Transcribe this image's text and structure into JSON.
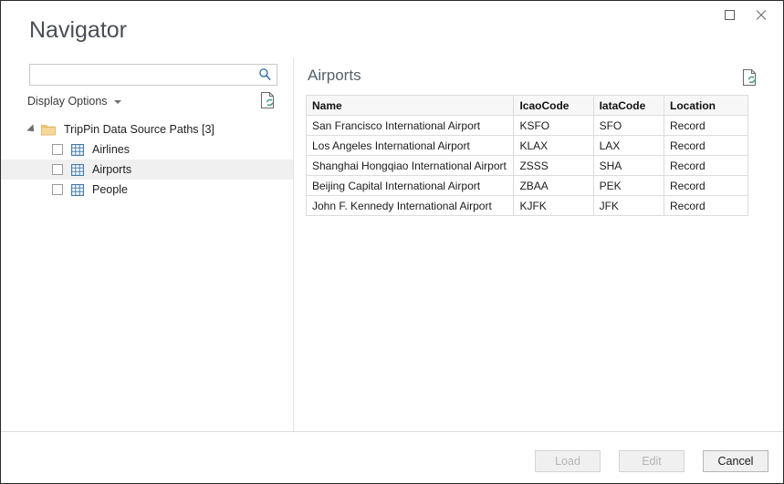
{
  "window": {
    "title": "Navigator",
    "controls": [
      {
        "name": "maximize-button",
        "icon": "maximize-icon",
        "label": "Maximize"
      },
      {
        "name": "close-button",
        "icon": "close-icon",
        "label": "Close"
      }
    ]
  },
  "search": {
    "value": "",
    "placeholder": "",
    "icon": "search-icon"
  },
  "display_options": {
    "label": "Display Options",
    "caret_icon": "chevron-down-icon"
  },
  "left_refresh": {
    "icon": "refresh-document-icon"
  },
  "right_refresh": {
    "icon": "refresh-document-icon"
  },
  "tree": {
    "root": {
      "label": "TripPin Data Source Paths [3]",
      "expander_icon": "expander-expanded-icon",
      "folder_icon": "folder-icon",
      "expanded": true
    },
    "items": [
      {
        "label": "Airlines",
        "checked": false,
        "selected": false,
        "icon": "table-grid-icon"
      },
      {
        "label": "Airports",
        "checked": false,
        "selected": true,
        "icon": "table-grid-icon"
      },
      {
        "label": "People",
        "checked": false,
        "selected": false,
        "icon": "table-grid-icon"
      }
    ]
  },
  "preview": {
    "title": "Airports",
    "columns": [
      "Name",
      "IcaoCode",
      "IataCode",
      "Location"
    ],
    "column_widths": [
      "47%",
      "18%",
      "16%",
      "19%"
    ],
    "rows": [
      [
        "San Francisco International Airport",
        "KSFO",
        "SFO",
        "Record"
      ],
      [
        "Los Angeles International Airport",
        "KLAX",
        "LAX",
        "Record"
      ],
      [
        "Shanghai Hongqiao International Airport",
        "ZSSS",
        "SHA",
        "Record"
      ],
      [
        "Beijing Capital International Airport",
        "ZBAA",
        "PEK",
        "Record"
      ],
      [
        "John F. Kennedy International Airport",
        "KJFK",
        "JFK",
        "Record"
      ]
    ]
  },
  "footer": {
    "buttons": [
      {
        "label": "Load",
        "enabled": false,
        "name": "load-button"
      },
      {
        "label": "Edit",
        "enabled": false,
        "name": "edit-button"
      },
      {
        "label": "Cancel",
        "enabled": true,
        "name": "cancel-button"
      }
    ]
  },
  "colors": {
    "accent_blue": "#2b6ca3",
    "folder_yellow": "#f2c878",
    "refresh_green": "#4b9e8c",
    "selection_grey": "#f0f0f0",
    "border_grey": "#dcdcdc",
    "title_text": "#4a4f56"
  }
}
